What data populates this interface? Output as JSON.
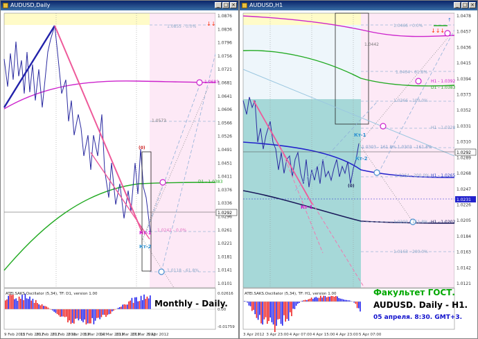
{
  "colors": {
    "bg_pink": "#fde9f6",
    "bg_teal": "#a6d8d8",
    "yellow": "#fffbc8",
    "candle_blue": "#3a3aa8",
    "candle_red": "#cc3030",
    "fib_label": "#8aa8c8",
    "magenta_ma": "#cc22cc",
    "green_ma": "#22aa22",
    "osc_red": "#ee2222",
    "osc_blue": "#2222ee",
    "promo_green": "#00a800",
    "promo_blue": "#1010cc"
  },
  "left": {
    "title": "AUDUSD,Daily",
    "price_ticks": [
      "1.0876",
      "1.0836",
      "1.0796",
      "1.0756",
      "1.0721",
      "1.0681",
      "1.0641",
      "1.0606",
      "1.0566",
      "1.0526",
      "1.0491",
      "1.0451",
      "1.0411",
      "1.0376",
      "1.0336",
      "1.0296",
      "1.0261",
      "1.0221",
      "1.0181",
      "1.0141",
      "1.0101"
    ],
    "current_price": "1.0292",
    "fib_top": "1.0855 - 0.0%",
    "magenta_label": "1.0683",
    "mid_label": "1.0573",
    "d1_label": "D1 - 1.0383",
    "fib_mid": "1.0242 - 0.0%",
    "fib_low": "1.0118 - 61.8%",
    "tag_red": "(0)",
    "tag_kt1": "Кт-1",
    "tag_kt2": "Кт-2",
    "osc_title": "ATEI.SAKS.Oscillator (5,34), TF: D1, version 1.00",
    "osc_ticks": [
      "0.02616",
      "0.00",
      "-0.01759"
    ],
    "dates": [
      "9 Feb 2012",
      "15 Feb 2012",
      "20 Feb 2012",
      "27 Feb 2012",
      "2 Mar 2012",
      "8 Mar 2012",
      "14 Mar 2012",
      "20 Mar 2012",
      "27 Mar 2012",
      "5 Apr 2012"
    ],
    "caption": "Monthly - Daily."
  },
  "right": {
    "title": "AUDUSD,H1",
    "price_ticks": [
      "1.0478",
      "1.0457",
      "1.0436",
      "1.0415",
      "1.0394",
      "1.0373",
      "1.0352",
      "1.0331",
      "1.0310",
      "1.0289",
      "1.0268",
      "1.0247",
      "1.0226",
      "1.0205",
      "1.0184",
      "1.0163",
      "1.0142",
      "1.0121"
    ],
    "current_price": "1.0292",
    "blue_price": "1.0231",
    "fib_top": "1.0466 - 0.0%",
    "fib_618": "1.0404 - 61.8%",
    "h1_label": "H1 - 1.0392",
    "d1_label": "D1 - 1.0383",
    "fib_100": "1.0366 - 100.0%",
    "h1_mid": "H1 - 1.0328",
    "fib_1618": "1.0303 - 161.8%  1.0303 - 161.8%",
    "h1_265": "H1 - 1.0265",
    "fib_200": "1.0264 - 200.0%",
    "fib_1618b": "1.0202 - 161.8%",
    "h1_202": "H1 - 1.0202",
    "fib_200b": "1.0163 - 200.0%",
    "box_label": "1.0442",
    "tag_kt1": "Кт-1",
    "tag_kt2": "Кт-2",
    "tag_zero": "(0)",
    "tag_kt1b": "Кт-1",
    "osc_title": "ATEI.SAKS.Oscillator (5,34), TF: H1, version 1.00",
    "dates": [
      "3 Apr 2012",
      "3 Apr 23:00",
      "4 Apr 07:00",
      "4 Apr 15:00",
      "4 Apr 23:00",
      "5 Apr 07:00"
    ],
    "promo_line1": "Факультет ГОСТ.",
    "promo_line2": "AUDUSD. Daily - H1.",
    "promo_line3": "05 апреля. 8:30. GMT+3."
  }
}
